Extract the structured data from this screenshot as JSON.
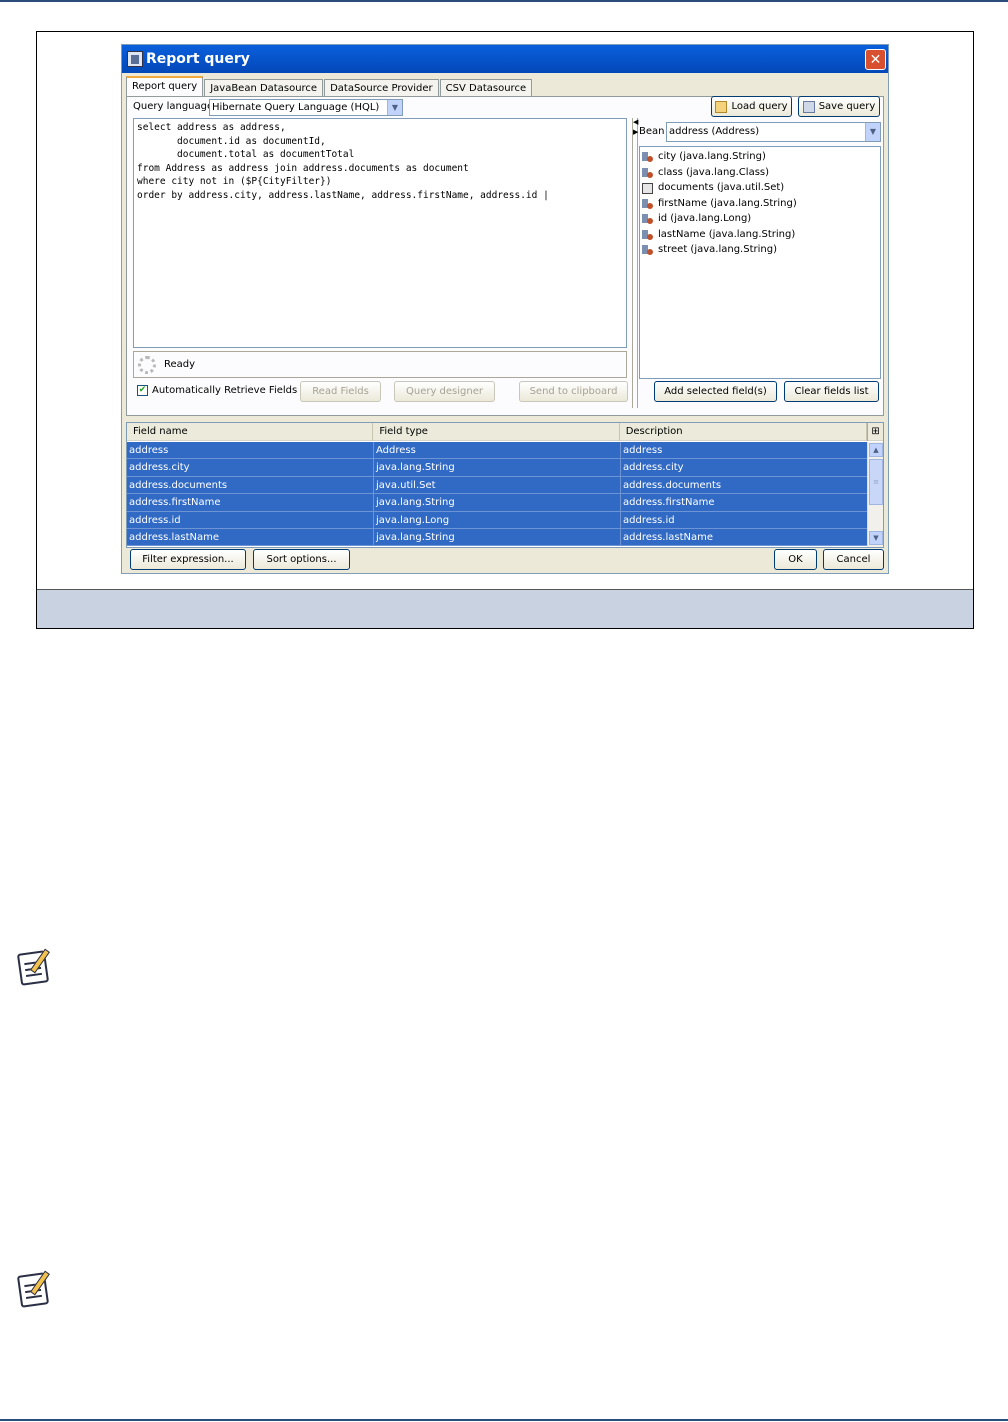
{
  "dialog": {
    "title": "Report query",
    "close_label": "✕"
  },
  "tabs": [
    "Report query",
    "JavaBean Datasource",
    "DataSource Provider",
    "CSV Datasource"
  ],
  "query": {
    "language_label": "Query language",
    "language_value": "Hibernate Query Language (HQL)",
    "load_label": "Load query",
    "save_label": "Save query",
    "text": "select address as address,\n       document.id as documentId,\n       document.total as documentTotal\nfrom Address as address join address.documents as document\nwhere city not in ($P{CityFilter})\norder by address.city, address.lastName, address.firstName, address.id |",
    "status": "Ready",
    "auto_retrieve_label": "Automatically Retrieve Fields",
    "auto_retrieve_checked": true,
    "read_fields_label": "Read Fields",
    "query_designer_label": "Query designer",
    "send_clipboard_label": "Send to clipboard"
  },
  "bean": {
    "label": "Bean",
    "value": "address (Address)",
    "fields": [
      {
        "label": "city (java.lang.String)",
        "icon": "field-icon"
      },
      {
        "label": "class (java.lang.Class)",
        "icon": "field-icon"
      },
      {
        "label": "documents (java.util.Set)",
        "icon": "set-icon"
      },
      {
        "label": "firstName (java.lang.String)",
        "icon": "field-icon"
      },
      {
        "label": "id (java.lang.Long)",
        "icon": "field-icon"
      },
      {
        "label": "lastName (java.lang.String)",
        "icon": "field-icon"
      },
      {
        "label": "street (java.lang.String)",
        "icon": "field-icon"
      }
    ],
    "add_selected_label": "Add selected field(s)",
    "clear_fields_label": "Clear fields list"
  },
  "table": {
    "columns": [
      "Field name",
      "Field type",
      "Description"
    ],
    "rows": [
      [
        "address",
        "Address",
        "address"
      ],
      [
        "address.city",
        "java.lang.String",
        "address.city"
      ],
      [
        "address.documents",
        "java.util.Set",
        "address.documents"
      ],
      [
        "address.firstName",
        "java.lang.String",
        "address.firstName"
      ],
      [
        "address.id",
        "java.lang.Long",
        "address.id"
      ],
      [
        "address.lastName",
        "java.lang.String",
        "address.lastName"
      ]
    ]
  },
  "footer": {
    "filter_label": "Filter expression...",
    "sort_label": "Sort options...",
    "ok_label": "OK",
    "cancel_label": "Cancel"
  },
  "colors": {
    "title_bar": "#0348b8",
    "selection": "#316ac5",
    "caption_band": "#c8d2e0"
  }
}
